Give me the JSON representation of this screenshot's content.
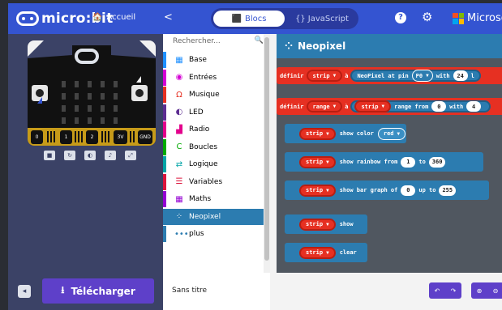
{
  "header": {
    "logo_text": "micro:bit",
    "home_label": "Accueil",
    "tab_blocks": "Blocs",
    "tab_js": "JavaScript",
    "help_glyph": "?",
    "brand": "Microsoft"
  },
  "simulator": {
    "pins": [
      "0",
      "1",
      "2",
      "3V",
      "GND"
    ],
    "controls": [
      "stop",
      "restart",
      "slow-motion",
      "mute",
      "fullscreen"
    ]
  },
  "toolbox": {
    "search_placeholder": "Rechercher...",
    "categories": [
      {
        "label": "Base",
        "color": "#1e90ff",
        "icon": "grid-icon"
      },
      {
        "label": "Entrées",
        "color": "#d400d4",
        "icon": "target-icon"
      },
      {
        "label": "Musique",
        "color": "#e63022",
        "icon": "headphones-icon"
      },
      {
        "label": "LED",
        "color": "#5c2d91",
        "icon": "toggle-icon"
      },
      {
        "label": "Radio",
        "color": "#e3008c",
        "icon": "signal-icon"
      },
      {
        "label": "Boucles",
        "color": "#00aa00",
        "icon": "loop-icon"
      },
      {
        "label": "Logique",
        "color": "#00a4a6",
        "icon": "shuffle-icon"
      },
      {
        "label": "Variables",
        "color": "#dc143c",
        "icon": "lines-icon"
      },
      {
        "label": "Maths",
        "color": "#9400d3",
        "icon": "calculator-icon"
      },
      {
        "label": "Neopixel",
        "color": "#2c7cb0",
        "icon": "spinner-icon"
      },
      {
        "label": "plus",
        "color": "#2c7cb0",
        "icon": "dots-icon"
      }
    ],
    "selected": "Neopixel"
  },
  "workspace": {
    "category_title": "Neopixel",
    "blocks": {
      "set_strip": {
        "kw": "définir",
        "var": "strip",
        "to": "à",
        "fn": "NeoPixel at pin",
        "pin": "P0",
        "with": "with",
        "count": "24",
        "tail": "l"
      },
      "set_range": {
        "kw": "définir",
        "var": "range",
        "to": "à",
        "strip": "strip",
        "fn": "range from",
        "from": "0",
        "with": "with",
        "count": "4"
      },
      "show_color": {
        "strip": "strip",
        "text": "show color",
        "color": "red"
      },
      "rainbow": {
        "strip": "strip",
        "text": "show rainbow from",
        "from": "1",
        "to_kw": "to",
        "to": "360"
      },
      "bar_graph": {
        "strip": "strip",
        "text": "show bar graph of",
        "of": "0",
        "up_kw": "up to",
        "max": "255"
      },
      "show": {
        "strip": "strip",
        "text": "show"
      },
      "clear": {
        "strip": "strip",
        "text": "clear"
      }
    }
  },
  "footer": {
    "download_label": "Télécharger",
    "project_name": "Sans titre"
  },
  "colors": {
    "topbar": "#3454d1",
    "neopixel": "#2c7cb0",
    "variables": "#e63022",
    "download": "#5e40c9"
  }
}
